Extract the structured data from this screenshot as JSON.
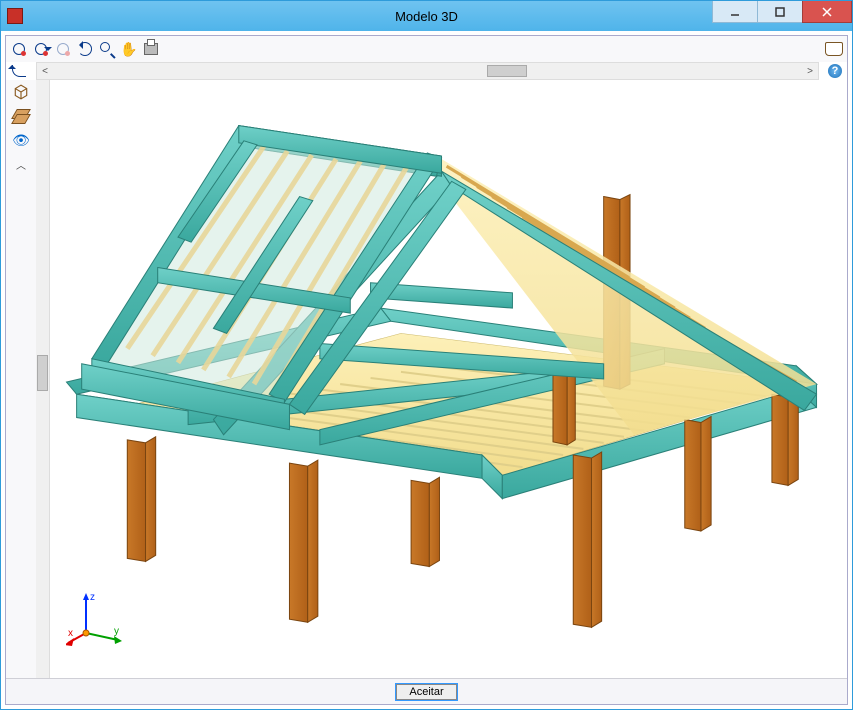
{
  "window": {
    "title": "Modelo 3D",
    "minimize": "–",
    "maximize": "▢",
    "close": "×"
  },
  "toolbar_top": {
    "orbit": "orbit",
    "orbit2": "orbit-constrained",
    "orbit_disabled": "orbit-free",
    "refresh": "refresh",
    "zoom": "zoom",
    "pan": "pan",
    "print": "print",
    "manual": "manual"
  },
  "row2": {
    "undo": "undo",
    "scroll_left": "<",
    "scroll_right": ">",
    "help": "?"
  },
  "vtoolbar": {
    "wireframe": "wireframe",
    "layers": "layers",
    "visibility": "visibility",
    "collapse": "collapse"
  },
  "axes": {
    "x": "x",
    "y": "y",
    "z": "z"
  },
  "bottom": {
    "accept": "Aceitar"
  }
}
